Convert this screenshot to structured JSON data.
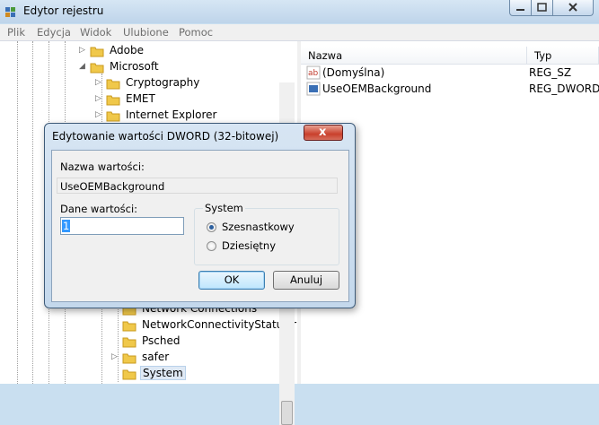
{
  "window": {
    "title": "Edytor rejestru"
  },
  "menu": [
    "Plik",
    "Edycja",
    "Widok",
    "Ulubione",
    "Pomoc"
  ],
  "tree": {
    "top_nodes": [
      {
        "label": "Adobe",
        "expander": "▷"
      },
      {
        "label": "Microsoft",
        "expander": "◢"
      }
    ],
    "microsoft_children": [
      {
        "label": "Cryptography",
        "expander": "▷"
      },
      {
        "label": "EMET",
        "expander": "▷"
      },
      {
        "label": "Internet Explorer",
        "expander": "▷"
      }
    ],
    "lower_children": [
      {
        "label": "Network Connections",
        "expander": ""
      },
      {
        "label": "NetworkConnectivityStatusIr",
        "expander": ""
      },
      {
        "label": "Psched",
        "expander": ""
      },
      {
        "label": "safer",
        "expander": "▷"
      },
      {
        "label": "System",
        "expander": "",
        "selected": true
      }
    ]
  },
  "list": {
    "columns": {
      "name": "Nazwa",
      "type": "Typ"
    },
    "rows": [
      {
        "name": "(Domyślna)",
        "type": "REG_SZ",
        "icon": "string-value-icon"
      },
      {
        "name": "UseOEMBackground",
        "type": "REG_DWORD",
        "icon": "binary-value-icon"
      }
    ]
  },
  "dialog": {
    "title": "Edytowanie wartości DWORD (32-bitowej)",
    "close_glyph": "x",
    "value_name_label": "Nazwa wartości:",
    "value_name": "UseOEMBackground",
    "value_data_label": "Dane wartości:",
    "value_data": "1",
    "base_group": "System",
    "base_hex": "Szesnastkowy",
    "base_dec": "Dziesiętny",
    "selected_base": "hex",
    "ok": "OK",
    "cancel": "Anuluj"
  },
  "colors": {
    "accent": "#3399ff",
    "titlebar": "#c9dff0",
    "close_button": "#c9402c"
  }
}
